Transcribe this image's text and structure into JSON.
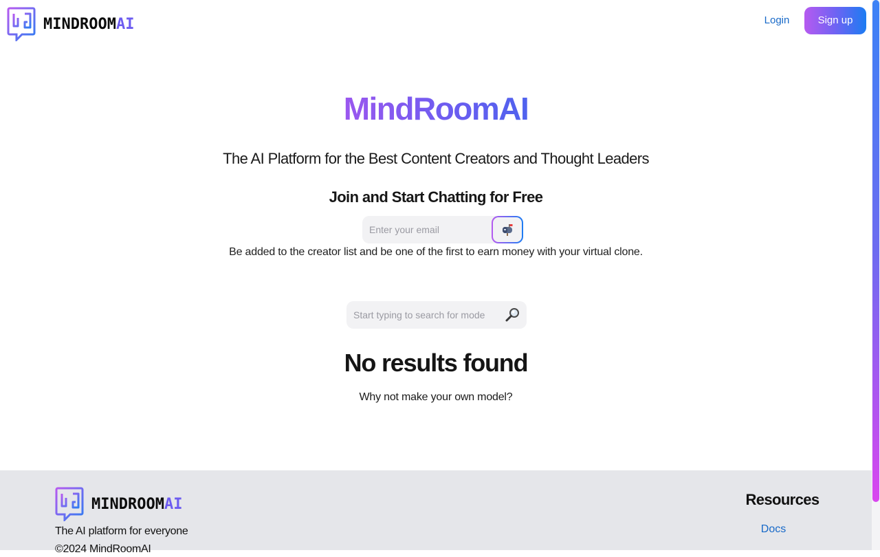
{
  "brand": {
    "name_main": "MINDROOM",
    "name_suffix": "AI",
    "logo_icon": "mindroom-logo-icon",
    "gradient_start": "#b65af0",
    "gradient_end": "#1c7cf2"
  },
  "header": {
    "login_label": "Login",
    "signup_label": "Sign up",
    "link_color": "#1769c8"
  },
  "hero": {
    "title": "MindRoomAI",
    "tagline": "The AI Platform for the Best Content Creators and Thought Leaders",
    "join_heading": "Join and Start Chatting for Free",
    "email_placeholder": "Enter your email",
    "email_submit_icon": "mailbox-icon",
    "subnote": "Be added to the creator list and be one of the first to earn money with your virtual clone."
  },
  "search": {
    "placeholder": "Start typing to search for mode",
    "icon": "magnifier-icon"
  },
  "results": {
    "empty_title": "No results found",
    "empty_subtitle": "Why not make your own model?"
  },
  "footer": {
    "tagline": "The AI platform for everyone",
    "copyright": "©2024 MindRoomAI",
    "resources_heading": "Resources",
    "docs_label": "Docs"
  }
}
